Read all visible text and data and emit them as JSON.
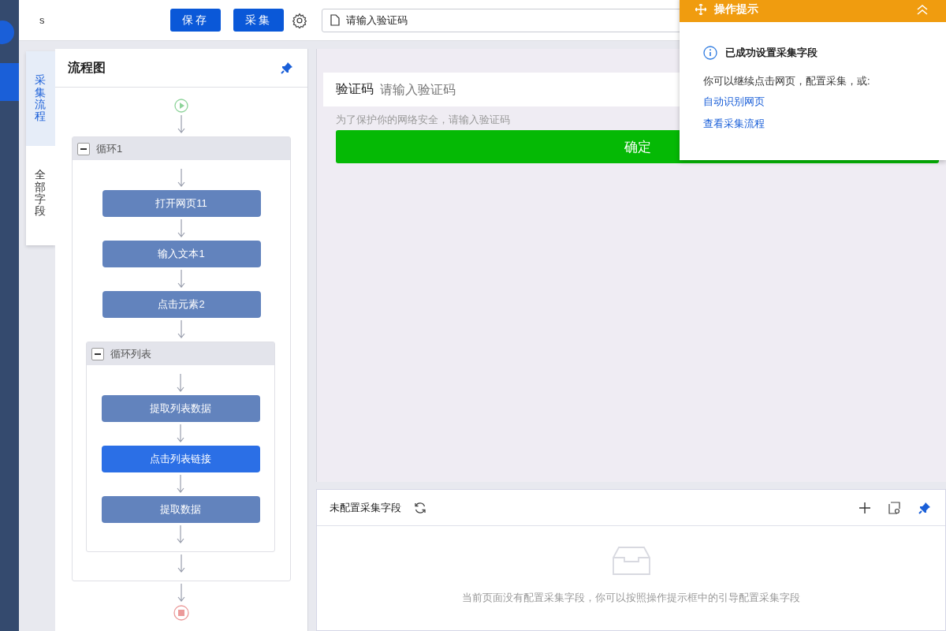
{
  "toolbar": {
    "title": "s",
    "buttons": [
      "保存",
      "采集"
    ],
    "url_field": {
      "value": "请输入验证码"
    }
  },
  "side_tabs": [
    {
      "label": "采集流程",
      "selected": true
    },
    {
      "label": "全部字段",
      "selected": false
    }
  ],
  "flow_panel": {
    "title": "流程图",
    "steps": [
      {
        "kind": "start"
      },
      {
        "kind": "loop",
        "label": "循环1",
        "expanded": true,
        "children": [
          {
            "kind": "action",
            "label": "打开网页11",
            "selected": false
          },
          {
            "kind": "action",
            "label": "输入文本1",
            "selected": false
          },
          {
            "kind": "action",
            "label": "点击元素2",
            "selected": false
          },
          {
            "kind": "loop",
            "label": "循环列表",
            "expanded": true,
            "children": [
              {
                "kind": "action",
                "label": "提取列表数据",
                "selected": false
              },
              {
                "kind": "action",
                "label": "点击列表链接",
                "selected": true
              },
              {
                "kind": "action",
                "label": "提取数据",
                "selected": false
              }
            ]
          }
        ]
      },
      {
        "kind": "end"
      }
    ]
  },
  "browser_page": {
    "field_label": "验证码",
    "field_placeholder": "请输入验证码",
    "hint": "为了保护你的网络安全，请输入验证码",
    "submit": "确定"
  },
  "fields_panel": {
    "title": "未配置采集字段",
    "empty_message": "当前页面没有配置采集字段，你可以按照操作提示框中的引导配置采集字段"
  },
  "tip_popup": {
    "title": "操作提示",
    "heading": "已成功设置采集字段",
    "text": "你可以继续点击网页，配置采集，或:",
    "links": [
      "自动识别网页",
      "查看采集流程"
    ]
  }
}
